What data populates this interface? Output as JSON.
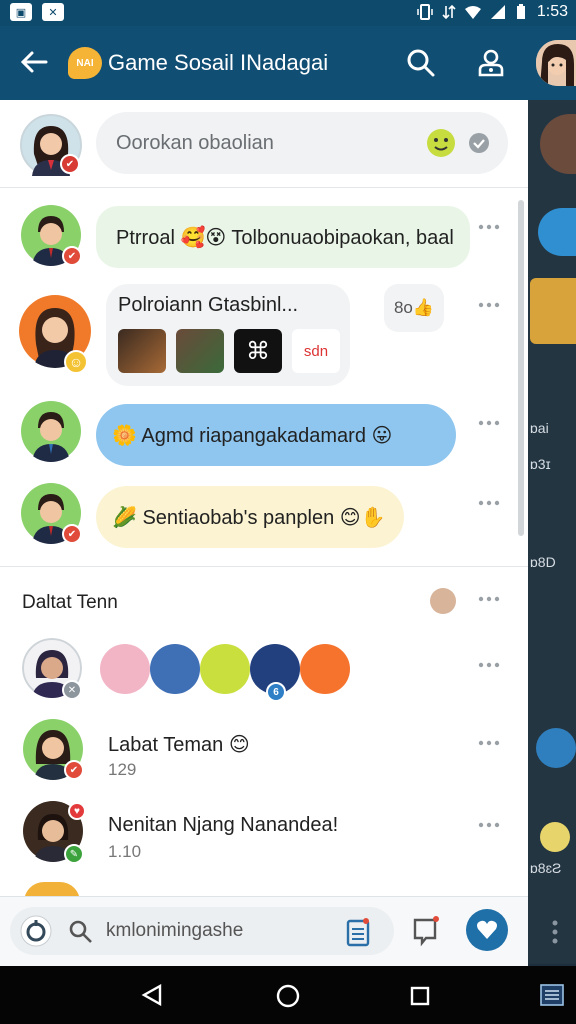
{
  "status_bar": {
    "left_icons": [
      "image-icon",
      "brand-icon"
    ],
    "time": "1:53",
    "right_icons": [
      "vibrate-icon",
      "data-icon",
      "wifi-icon",
      "signal-icon",
      "battery-icon"
    ]
  },
  "app_bar": {
    "title": "Game Sosail INadagai",
    "logo_text": "NAI",
    "actions": [
      "search-icon",
      "profile-icon"
    ]
  },
  "compose": {
    "placeholder": "Oorokan obaolian"
  },
  "feed": {
    "posts": [
      {
        "text": "Ptrroal 🥰😵 Tolbonuaobipaokan, baal",
        "bubble_color": "#e9f6e7"
      },
      {
        "text": "Polroiann Gtasbinl...",
        "reaction": "8o👍",
        "media_text": "sdn",
        "bubble_color": "#f2f3f4"
      },
      {
        "text": "🌼 Agmd riapangakadamard 😛",
        "bubble_color": "#8ec6ef"
      },
      {
        "text": "🌽 Sentiaobab's panplen 😊✋",
        "bubble_color": "#fbf3d2"
      }
    ]
  },
  "friends_section": {
    "title": "Daltat Tenn",
    "avatar_badge_number": "6",
    "friends": [
      {
        "name": "Labat Teman 😊",
        "count": "129"
      },
      {
        "name": "Nenitan Njang Nanandea!",
        "count": "1.10"
      }
    ]
  },
  "bottom_bar": {
    "search_placeholder": "kmlonimingashe"
  },
  "side_panel": {
    "labels": [
      "ɒai",
      "ɒ3ɪ",
      "ɒ8D",
      "ɒ8ɛƧ"
    ]
  },
  "nav_bar": {
    "buttons": [
      "back-icon",
      "home-icon",
      "recents-icon"
    ]
  },
  "colors": {
    "primary": "#114e73",
    "status_bar": "#0e4a6c",
    "accent_blue": "#1f6fa8",
    "bubble_green": "#e9f6e7",
    "bubble_blue": "#8ec6ef",
    "bubble_yellow": "#fbf3d2"
  }
}
